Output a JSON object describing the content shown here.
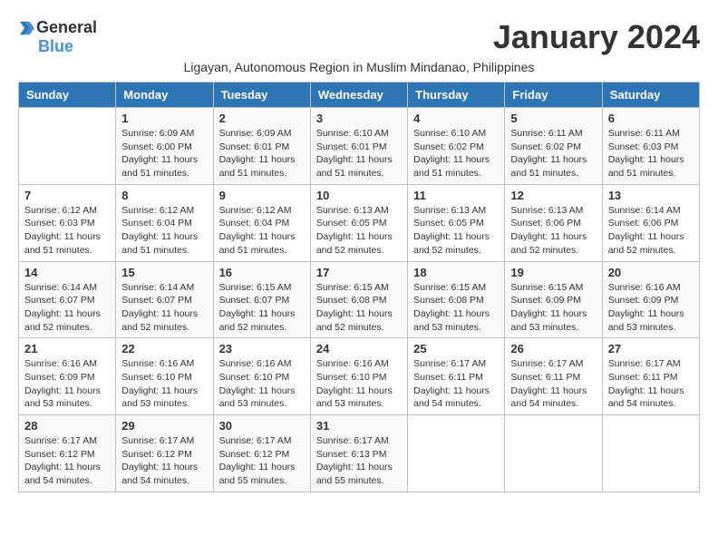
{
  "logo": {
    "general": "General",
    "blue": "Blue"
  },
  "title": "January 2024",
  "subtitle": "Ligayan, Autonomous Region in Muslim Mindanao, Philippines",
  "headers": [
    "Sunday",
    "Monday",
    "Tuesday",
    "Wednesday",
    "Thursday",
    "Friday",
    "Saturday"
  ],
  "weeks": [
    [
      {
        "day": "",
        "info": ""
      },
      {
        "day": "1",
        "info": "Sunrise: 6:09 AM\nSunset: 6:00 PM\nDaylight: 11 hours\nand 51 minutes."
      },
      {
        "day": "2",
        "info": "Sunrise: 6:09 AM\nSunset: 6:01 PM\nDaylight: 11 hours\nand 51 minutes."
      },
      {
        "day": "3",
        "info": "Sunrise: 6:10 AM\nSunset: 6:01 PM\nDaylight: 11 hours\nand 51 minutes."
      },
      {
        "day": "4",
        "info": "Sunrise: 6:10 AM\nSunset: 6:02 PM\nDaylight: 11 hours\nand 51 minutes."
      },
      {
        "day": "5",
        "info": "Sunrise: 6:11 AM\nSunset: 6:02 PM\nDaylight: 11 hours\nand 51 minutes."
      },
      {
        "day": "6",
        "info": "Sunrise: 6:11 AM\nSunset: 6:03 PM\nDaylight: 11 hours\nand 51 minutes."
      }
    ],
    [
      {
        "day": "7",
        "info": "Sunrise: 6:12 AM\nSunset: 6:03 PM\nDaylight: 11 hours\nand 51 minutes."
      },
      {
        "day": "8",
        "info": "Sunrise: 6:12 AM\nSunset: 6:04 PM\nDaylight: 11 hours\nand 51 minutes."
      },
      {
        "day": "9",
        "info": "Sunrise: 6:12 AM\nSunset: 6:04 PM\nDaylight: 11 hours\nand 51 minutes."
      },
      {
        "day": "10",
        "info": "Sunrise: 6:13 AM\nSunset: 6:05 PM\nDaylight: 11 hours\nand 52 minutes."
      },
      {
        "day": "11",
        "info": "Sunrise: 6:13 AM\nSunset: 6:05 PM\nDaylight: 11 hours\nand 52 minutes."
      },
      {
        "day": "12",
        "info": "Sunrise: 6:13 AM\nSunset: 6:06 PM\nDaylight: 11 hours\nand 52 minutes."
      },
      {
        "day": "13",
        "info": "Sunrise: 6:14 AM\nSunset: 6:06 PM\nDaylight: 11 hours\nand 52 minutes."
      }
    ],
    [
      {
        "day": "14",
        "info": "Sunrise: 6:14 AM\nSunset: 6:07 PM\nDaylight: 11 hours\nand 52 minutes."
      },
      {
        "day": "15",
        "info": "Sunrise: 6:14 AM\nSunset: 6:07 PM\nDaylight: 11 hours\nand 52 minutes."
      },
      {
        "day": "16",
        "info": "Sunrise: 6:15 AM\nSunset: 6:07 PM\nDaylight: 11 hours\nand 52 minutes."
      },
      {
        "day": "17",
        "info": "Sunrise: 6:15 AM\nSunset: 6:08 PM\nDaylight: 11 hours\nand 52 minutes."
      },
      {
        "day": "18",
        "info": "Sunrise: 6:15 AM\nSunset: 6:08 PM\nDaylight: 11 hours\nand 53 minutes."
      },
      {
        "day": "19",
        "info": "Sunrise: 6:15 AM\nSunset: 6:09 PM\nDaylight: 11 hours\nand 53 minutes."
      },
      {
        "day": "20",
        "info": "Sunrise: 6:16 AM\nSunset: 6:09 PM\nDaylight: 11 hours\nand 53 minutes."
      }
    ],
    [
      {
        "day": "21",
        "info": "Sunrise: 6:16 AM\nSunset: 6:09 PM\nDaylight: 11 hours\nand 53 minutes."
      },
      {
        "day": "22",
        "info": "Sunrise: 6:16 AM\nSunset: 6:10 PM\nDaylight: 11 hours\nand 53 minutes."
      },
      {
        "day": "23",
        "info": "Sunrise: 6:16 AM\nSunset: 6:10 PM\nDaylight: 11 hours\nand 53 minutes."
      },
      {
        "day": "24",
        "info": "Sunrise: 6:16 AM\nSunset: 6:10 PM\nDaylight: 11 hours\nand 53 minutes."
      },
      {
        "day": "25",
        "info": "Sunrise: 6:17 AM\nSunset: 6:11 PM\nDaylight: 11 hours\nand 54 minutes."
      },
      {
        "day": "26",
        "info": "Sunrise: 6:17 AM\nSunset: 6:11 PM\nDaylight: 11 hours\nand 54 minutes."
      },
      {
        "day": "27",
        "info": "Sunrise: 6:17 AM\nSunset: 6:11 PM\nDaylight: 11 hours\nand 54 minutes."
      }
    ],
    [
      {
        "day": "28",
        "info": "Sunrise: 6:17 AM\nSunset: 6:12 PM\nDaylight: 11 hours\nand 54 minutes."
      },
      {
        "day": "29",
        "info": "Sunrise: 6:17 AM\nSunset: 6:12 PM\nDaylight: 11 hours\nand 54 minutes."
      },
      {
        "day": "30",
        "info": "Sunrise: 6:17 AM\nSunset: 6:12 PM\nDaylight: 11 hours\nand 55 minutes."
      },
      {
        "day": "31",
        "info": "Sunrise: 6:17 AM\nSunset: 6:13 PM\nDaylight: 11 hours\nand 55 minutes."
      },
      {
        "day": "",
        "info": ""
      },
      {
        "day": "",
        "info": ""
      },
      {
        "day": "",
        "info": ""
      }
    ]
  ]
}
